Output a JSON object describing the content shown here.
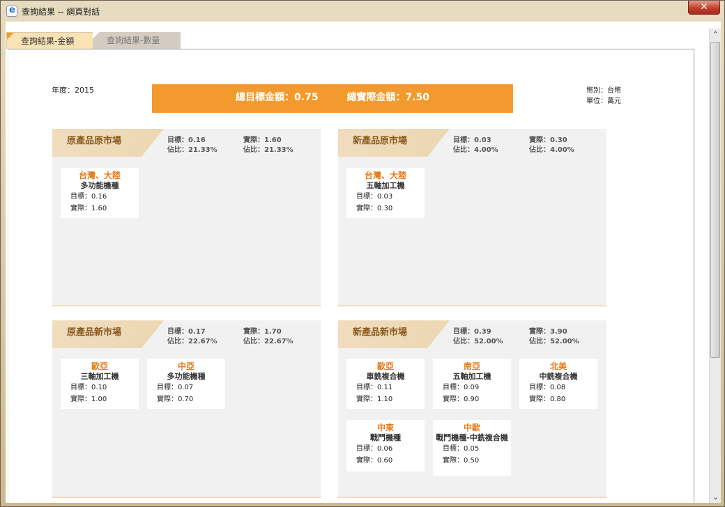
{
  "window": {
    "title": "查詢結果 -- 網頁對話",
    "close_label": "✕"
  },
  "tabs": [
    {
      "label": "查詢結果-金額",
      "active": true
    },
    {
      "label": "查詢結果-數量",
      "active": false
    }
  ],
  "header": {
    "year": "年度：2015",
    "currency": "幣別：台幣",
    "unit": "單位：萬元",
    "total_target": "總目標金額：0.75",
    "total_actual": "總實際金額：7.50"
  },
  "panels": [
    {
      "title": "原產品原市場",
      "target": "目標：0.16",
      "actual": "實際：1.60",
      "target_share": "佔比：21.33%",
      "actual_share": "佔比：21.33%",
      "cards": [
        {
          "region": "台灣、大陸",
          "product": "多功能機種",
          "target": "目標：0.16",
          "actual": "實際：1.60"
        }
      ]
    },
    {
      "title": "新產品原市場",
      "target": "目標：0.03",
      "actual": "實際：0.30",
      "target_share": "佔比：4.00%",
      "actual_share": "佔比：4.00%",
      "cards": [
        {
          "region": "台灣、大陸",
          "product": "五軸加工機",
          "target": "目標：0.03",
          "actual": "實際：0.30"
        }
      ]
    },
    {
      "title": "原產品新市場",
      "target": "目標：0.17",
      "actual": "實際：1.70",
      "target_share": "佔比：22.67%",
      "actual_share": "佔比：22.67%",
      "cards": [
        {
          "region": "歐亞",
          "product": "三軸加工機",
          "target": "目標：0.10",
          "actual": "實際：1.00"
        },
        {
          "region": "中亞",
          "product": "多功能機種",
          "target": "目標：0.07",
          "actual": "實際：0.70"
        }
      ]
    },
    {
      "title": "新產品新市場",
      "target": "目標：0.39",
      "actual": "實際：3.90",
      "target_share": "佔比：52.00%",
      "actual_share": "佔比：52.00%",
      "cards": [
        {
          "region": "歐亞",
          "product": "車銑複合機",
          "target": "目標：0.11",
          "actual": "實際：1.10"
        },
        {
          "region": "南亞",
          "product": "五軸加工機",
          "target": "目標：0.09",
          "actual": "實際：0.90"
        },
        {
          "region": "北美",
          "product": "中銑複合機",
          "target": "目標：0.08",
          "actual": "實際：0.80"
        },
        {
          "region": "中東",
          "product": "戰鬥機種",
          "target": "目標：0.06",
          "actual": "實際：0.60"
        },
        {
          "region": "中歐",
          "product": "戰鬥機種-中銑複合機",
          "target": "目標：0.05",
          "actual": "實際：0.50"
        }
      ]
    }
  ],
  "scrollbar": {
    "up_icon": "chevron-up-icon",
    "down_icon": "chevron-down-icon"
  }
}
